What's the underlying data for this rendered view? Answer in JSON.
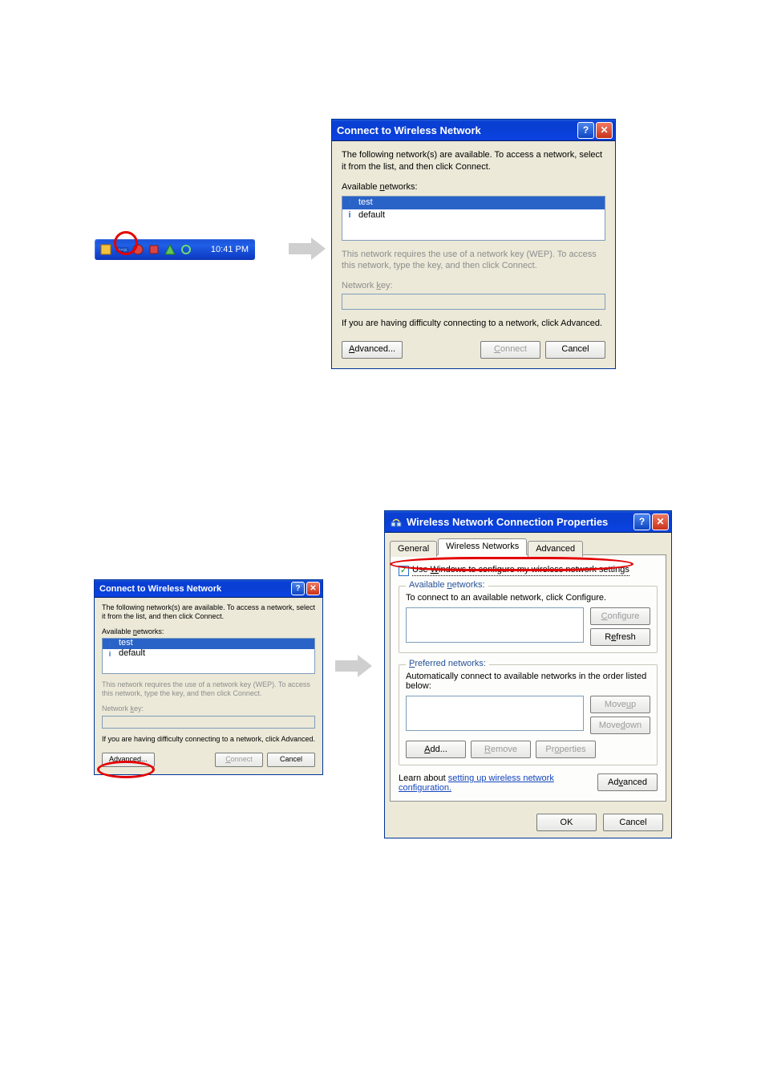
{
  "colors": {
    "accent": "#1546bf",
    "highlight_red": "#e30000"
  },
  "systray": {
    "time": "10:41 PM"
  },
  "connect_dialog": {
    "title": "Connect to Wireless Network",
    "intro": "The following network(s) are available. To access a network, select it from the list, and then click Connect.",
    "available_label": "Available networks:",
    "networks": [
      {
        "name": "test",
        "selected": true
      },
      {
        "name": "default",
        "selected": false
      }
    ],
    "wep_note": "This network requires the use of a network key (WEP). To access this network, type the key, and then click Connect.",
    "network_key_label": "Network key:",
    "difficulty_note": "If you are having difficulty connecting to a network, click Advanced.",
    "buttons": {
      "advanced": "Advanced...",
      "connect": "Connect",
      "cancel": "Cancel"
    }
  },
  "properties_dialog": {
    "title": "Wireless Network Connection Properties",
    "tabs": {
      "general": "General",
      "wireless": "Wireless Networks",
      "advanced": "Advanced"
    },
    "use_windows_check": "Use Windows to configure my wireless network settings",
    "available_legend": "Available networks:",
    "available_help": "To connect to an available network, click Configure.",
    "configure_btn": "Configure",
    "refresh_btn": "Refresh",
    "preferred_legend": "Preferred networks:",
    "preferred_help": "Automatically connect to available networks in the order listed below:",
    "moveup_btn": "Move up",
    "movedown_btn": "Move down",
    "add_btn": "Add...",
    "remove_btn": "Remove",
    "props_btn": "Properties",
    "learn_prefix": "Learn about ",
    "learn_link": "setting up wireless network configuration.",
    "advanced_btn": "Advanced",
    "ok_btn": "OK",
    "cancel_btn": "Cancel"
  }
}
